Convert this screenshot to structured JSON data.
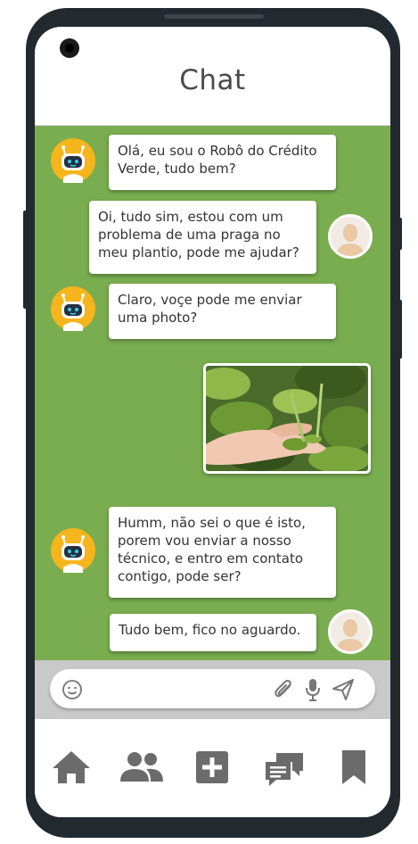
{
  "header": {
    "title": "Chat"
  },
  "messages": [
    {
      "sender": "bot",
      "text": "Olá, eu sou o Robô do Crédito Verde, tudo bem?"
    },
    {
      "sender": "user",
      "text": "Oi, tudo sim, estou com um problema de uma praga no meu plantio, pode me ajudar?"
    },
    {
      "sender": "bot",
      "text": "Claro, voçe pode me enviar uma photo?"
    },
    {
      "sender": "user",
      "type": "image",
      "image": "plant-leaves-in-hand-photo"
    },
    {
      "sender": "bot",
      "text": "Humm, não sei o que é isto, porem vou enviar a nosso técnico, e entro em contato contigo, pode ser?"
    },
    {
      "sender": "user",
      "text": "Tudo bem, fico no aguardo."
    }
  ],
  "input": {
    "value": "",
    "icons": [
      "smiley-icon",
      "paperclip-icon",
      "microphone-icon",
      "send-icon"
    ]
  },
  "bottom_nav": {
    "items": [
      "home-icon",
      "people-icon",
      "add-square-icon",
      "chat-bubbles-icon",
      "bookmark-icon"
    ]
  },
  "colors": {
    "chat_background": "#79ad4f",
    "bot_avatar": "#f6b51c",
    "input_bar": "#c9c9c9",
    "nav_icons": "#6b6b6b",
    "phone_frame": "#222a30"
  }
}
